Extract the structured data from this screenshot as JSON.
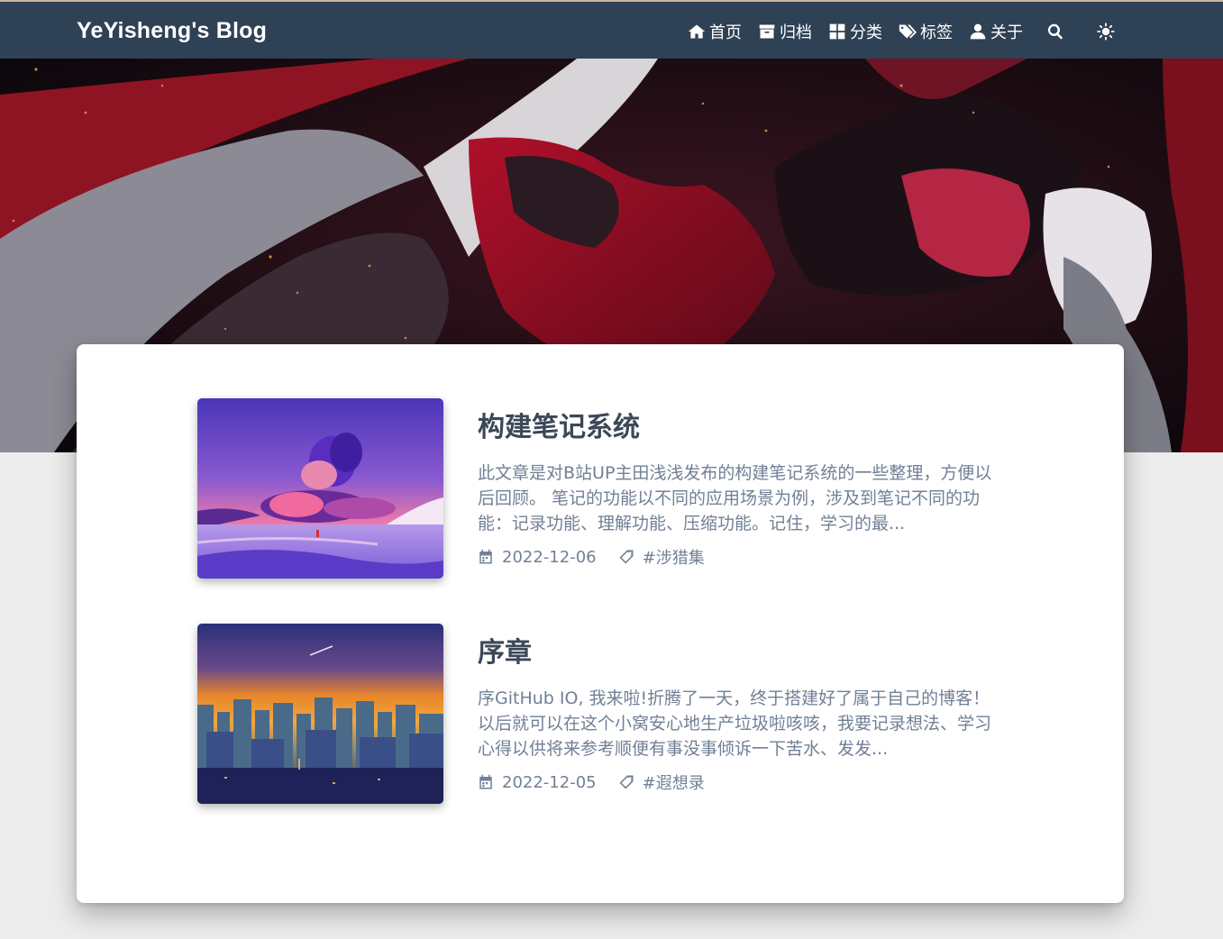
{
  "site": {
    "brand": "YeYisheng's Blog"
  },
  "nav": {
    "items": [
      {
        "label": "首页",
        "icon": "home-icon"
      },
      {
        "label": "归档",
        "icon": "archive-icon"
      },
      {
        "label": "分类",
        "icon": "categories-icon"
      },
      {
        "label": "标签",
        "icon": "tags-icon"
      },
      {
        "label": "关于",
        "icon": "user-icon"
      }
    ],
    "search_icon": "search-icon",
    "theme_icon": "sun-icon"
  },
  "posts": [
    {
      "title": "构建笔记系统",
      "excerpt": "此文章是对B站UP主田浅浅发布的构建笔记系统的一些整理，方便以后回顾。 笔记的功能以不同的应用场景为例，涉及到笔记不同的功能：记录功能、理解功能、压缩功能。记住，学习的最...",
      "date": "2022-12-06",
      "tag": "#涉猎集",
      "thumb_icon": "pink-clouds-thumbnail"
    },
    {
      "title": "序章",
      "excerpt": "序GitHub IO, 我来啦!折腾了一天，终于搭建好了属于自己的博客！以后就可以在这个小窝安心地生产垃圾啦咳咳，我要记录想法、学习心得以供将来参考顺便有事没事倾诉一下苦水、发发...",
      "date": "2022-12-05",
      "tag": "#遐想录",
      "thumb_icon": "city-sunset-thumbnail"
    }
  ],
  "colors": {
    "navbar": "#2f4154",
    "title_text": "#3c4858",
    "muted_text": "#718096",
    "page_bg": "#ececec"
  }
}
